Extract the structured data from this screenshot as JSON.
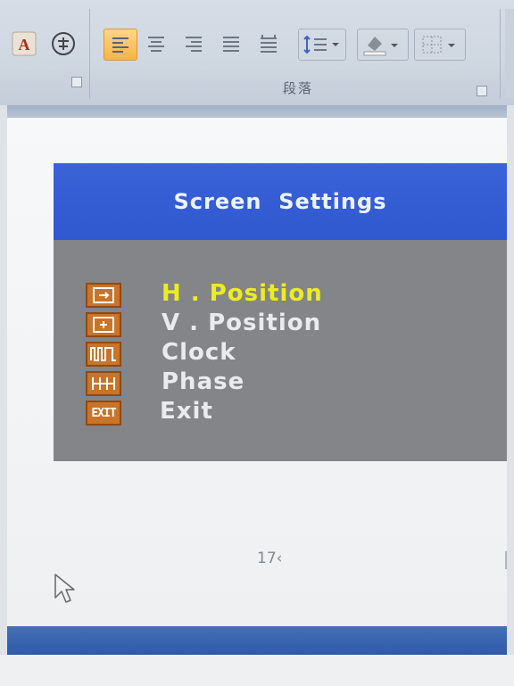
{
  "ribbon": {
    "group_label": "段落",
    "buttons": [
      {
        "name": "char-style-a-icon",
        "group": "font"
      },
      {
        "name": "enclose-char-icon",
        "group": "font"
      },
      {
        "name": "align-left-icon",
        "group": "paragraph",
        "active": true
      },
      {
        "name": "align-center-icon",
        "group": "paragraph"
      },
      {
        "name": "align-right-icon",
        "group": "paragraph"
      },
      {
        "name": "justify-icon",
        "group": "paragraph"
      },
      {
        "name": "distributed-icon",
        "group": "paragraph"
      },
      {
        "name": "line-spacing-icon",
        "group": "paragraph"
      },
      {
        "name": "shading-icon",
        "group": "paragraph"
      },
      {
        "name": "borders-icon",
        "group": "paragraph"
      }
    ],
    "accent_color": "#f6b545"
  },
  "osd": {
    "title": "Screen  Settings",
    "header_color": "#2f58cf",
    "body_color": "#838588",
    "selected_color": "#ecec22",
    "items": [
      {
        "label": "H . Position",
        "icon": "h-position-icon",
        "selected": true
      },
      {
        "label": "V . Position",
        "icon": "v-position-icon",
        "selected": false
      },
      {
        "label": "Clock",
        "icon": "clock-wave-icon",
        "selected": false
      },
      {
        "label": "Phase",
        "icon": "phase-icon",
        "selected": false
      },
      {
        "label": "Exit",
        "icon": "exit-icon",
        "selected": false,
        "icon_text": "EXIT"
      }
    ]
  },
  "page": {
    "number": "17‹"
  }
}
